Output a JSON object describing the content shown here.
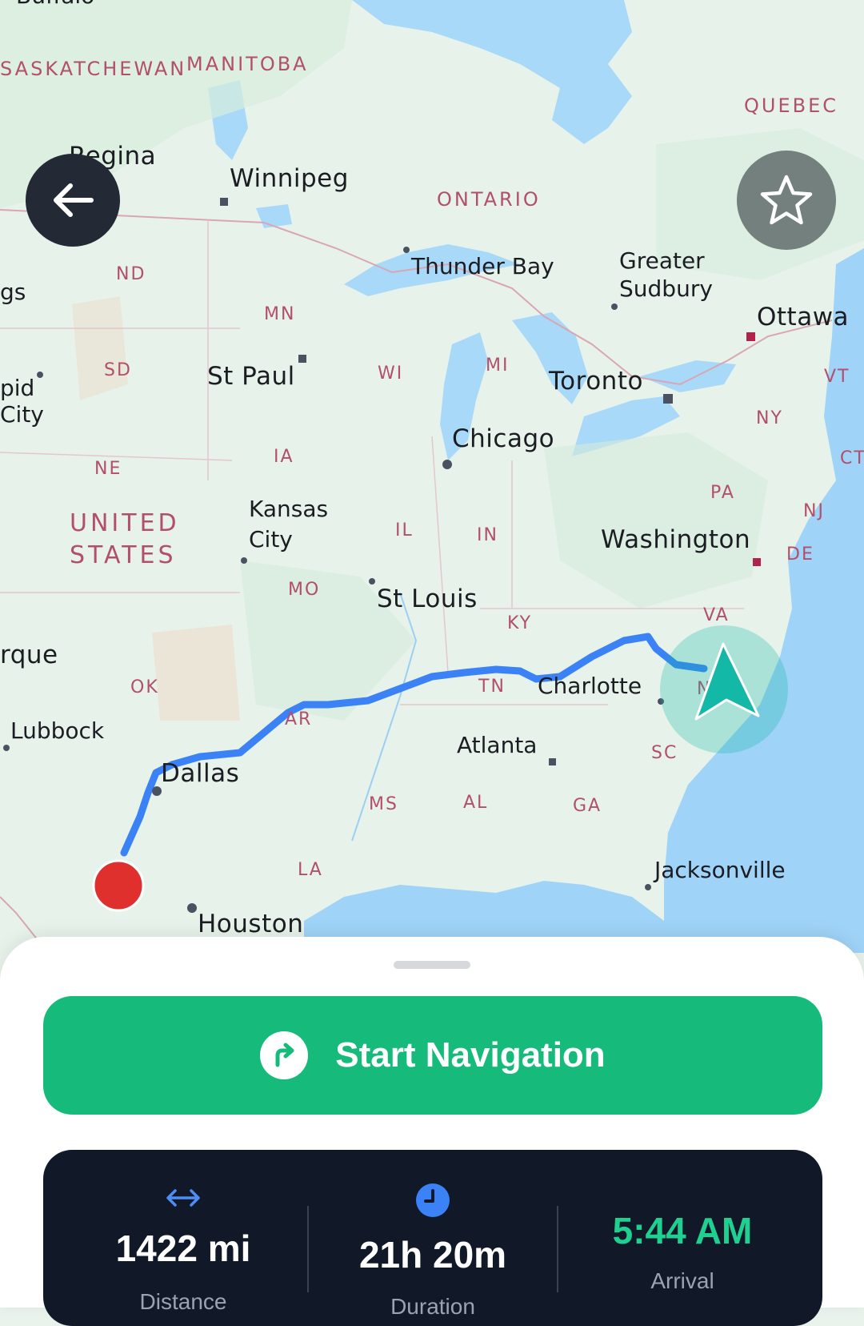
{
  "map": {
    "labels": {
      "buffalo": "Buffalo",
      "saskatchewan": "SASKATCHEWAN",
      "manitoba": "MANITOBA",
      "quebec": "QUEBEC",
      "regina": "Regina",
      "winnipeg": "Winnipeg",
      "ontario": "ONTARIO",
      "thunder_bay": "Thunder Bay",
      "greater_sudbury": "Greater\nSudbury",
      "ottawa": "Ottawa",
      "nd": "ND",
      "gs": "gs",
      "mn": "MN",
      "sd": "SD",
      "st_paul": "St Paul",
      "wi": "WI",
      "mi": "MI",
      "toronto": "Toronto",
      "vt": "VT",
      "rapid_city": "pid\nCity",
      "ny": "NY",
      "chicago": "Chicago",
      "ct": "CT",
      "ne": "NE",
      "ia": "IA",
      "pa": "PA",
      "nj": "NJ",
      "united_states": "UNITED\nSTATES",
      "kansas_city": "Kansas\nCity",
      "il": "IL",
      "in": "IN",
      "washington": "Washington",
      "de": "DE",
      "mo": "MO",
      "st_louis": "St Louis",
      "va": "VA",
      "ky": "KY",
      "albuquerque": "rque",
      "ok": "OK",
      "tn": "TN",
      "charlotte": "Charlotte",
      "nc": "N",
      "ar": "AR",
      "lubbock": "Lubbock",
      "atlanta": "Atlanta",
      "sc": "SC",
      "dallas": "Dallas",
      "ms": "MS",
      "al": "AL",
      "ga": "GA",
      "la": "LA",
      "jacksonville": "Jacksonville",
      "houston": "Houston"
    }
  },
  "icons": {
    "back": "arrow-left-icon",
    "favorite": "star-outline-icon",
    "turn": "turn-right-icon",
    "distance": "double-arrow-icon",
    "duration": "clock-icon",
    "current_location": "navigation-arrow-icon",
    "destination": "destination-dot-icon"
  },
  "colors": {
    "primary_green": "#16bb7c",
    "route_blue": "#3b82f6",
    "panel_dark": "#111827",
    "arrival_green": "#1fd191",
    "destination_red": "#e0302e",
    "location_teal": "#13b8a6"
  },
  "navigation": {
    "start_label": "Start Navigation"
  },
  "stats": {
    "distance": {
      "value": "1422 mi",
      "label": "Distance"
    },
    "duration": {
      "value": "21h 20m",
      "label": "Duration"
    },
    "arrival": {
      "value": "5:44 AM",
      "label": "Arrival"
    }
  }
}
